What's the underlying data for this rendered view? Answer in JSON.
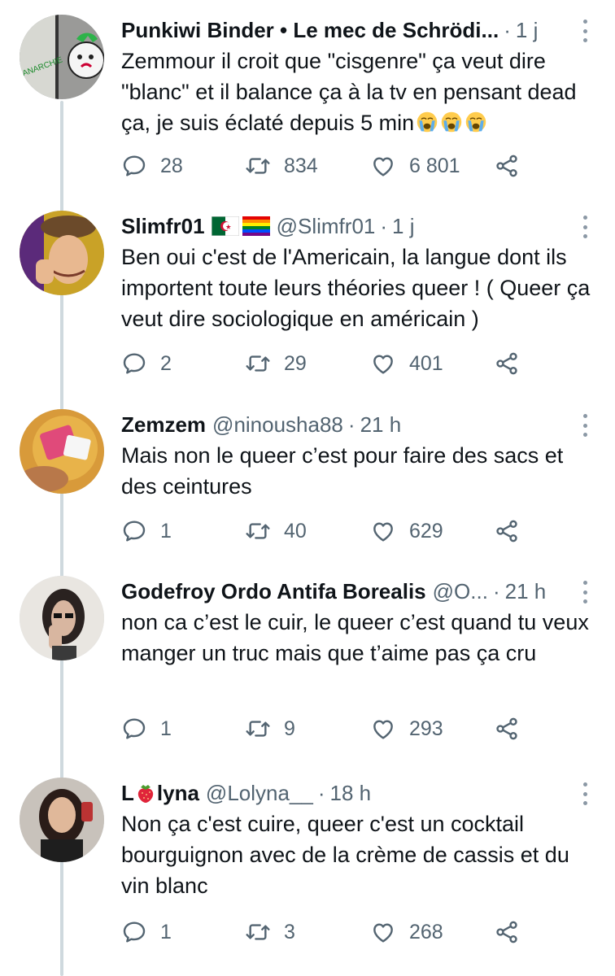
{
  "tweets": [
    {
      "name": "Punkiwi Binder • Le mec de Schrödi...",
      "handle": "",
      "time": "1 j",
      "text": "Zemmour il croit que \"cisgenre\" ça veut dire \"blanc\" et il balance ça à la tv en pensant dead ça, je suis éclaté depuis 5 min",
      "replies": "28",
      "retweets": "834",
      "likes": "6 801"
    },
    {
      "name": "Slimfr01",
      "handle": "@Slimfr01",
      "time": "1 j",
      "text": "Ben oui c'est de l'Americain, la langue dont ils importent toute leurs théories queer ! ( Queer ça veut dire sociologique en américain )",
      "replies": "2",
      "retweets": "29",
      "likes": "401"
    },
    {
      "name": "Zemzem",
      "handle": "@ninousha88",
      "time": "21 h",
      "text": "Mais non le queer c’est pour faire des sacs et des ceintures",
      "replies": "1",
      "retweets": "40",
      "likes": "629"
    },
    {
      "name": "Godefroy Ordo Antifa Borealis",
      "handle": "@O...",
      "time": "21 h",
      "text": "non ca c’est le cuir, le queer c’est quand tu veux manger un truc mais que t’aime pas ça cru",
      "replies": "1",
      "retweets": "9",
      "likes": "293"
    },
    {
      "name_prefix": "L",
      "name_suffix": "lyna",
      "handle": "@Lolyna__",
      "time": "18 h",
      "text": "Non ça c'est cuire, queer c'est un cocktail bourguignon avec de la crème de cassis et du vin blanc",
      "replies": "1",
      "retweets": "3",
      "likes": "268"
    }
  ],
  "separator": "·",
  "colors": {
    "text": "#0f1419",
    "secondary": "#536471",
    "thread": "#cfd9de"
  }
}
